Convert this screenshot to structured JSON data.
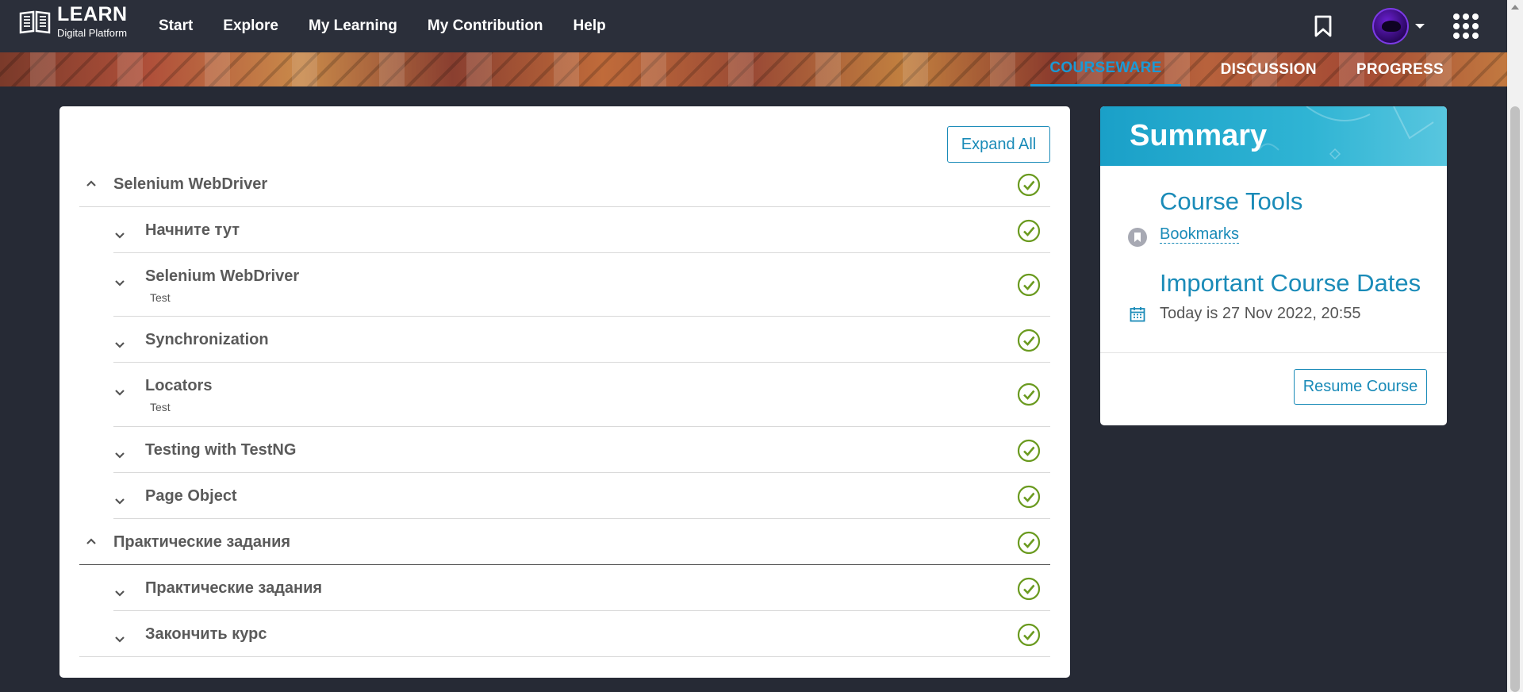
{
  "nav": {
    "logo_title": "LEARN",
    "logo_subtitle": "Digital Platform",
    "links": [
      "Start",
      "Explore",
      "My Learning",
      "My Contribution",
      "Help"
    ]
  },
  "tabs": [
    "COURSEWARE",
    "DISCUSSION",
    "PROGRESS"
  ],
  "outline": {
    "expand_label": "Expand All",
    "rows": [
      {
        "title": "Selenium WebDriver",
        "level": "section",
        "subtitle": ""
      },
      {
        "title": "Начните тут",
        "level": "sub",
        "subtitle": ""
      },
      {
        "title": "Selenium WebDriver",
        "level": "sub",
        "subtitle": "Test"
      },
      {
        "title": "Synchronization",
        "level": "sub",
        "subtitle": ""
      },
      {
        "title": "Locators",
        "level": "sub",
        "subtitle": "Test"
      },
      {
        "title": "Testing with TestNG",
        "level": "sub",
        "subtitle": ""
      },
      {
        "title": "Page Object",
        "level": "sub",
        "subtitle": ""
      },
      {
        "title": "Практические задания",
        "level": "section",
        "subtitle": ""
      },
      {
        "title": "Практические задания",
        "level": "sub",
        "subtitle": ""
      },
      {
        "title": "Закончить курс",
        "level": "sub",
        "subtitle": ""
      }
    ]
  },
  "summary": {
    "title": "Summary",
    "course_tools_heading": "Course Tools",
    "bookmarks_link": "Bookmarks",
    "dates_heading": "Important Course Dates",
    "today_text": "Today is 27 Nov 2022, 20:55",
    "resume_label": "Resume Course"
  },
  "colors": {
    "accent": "#1a8bb8",
    "check": "#6a9a1f",
    "nav_bg": "#2b2f3a"
  }
}
